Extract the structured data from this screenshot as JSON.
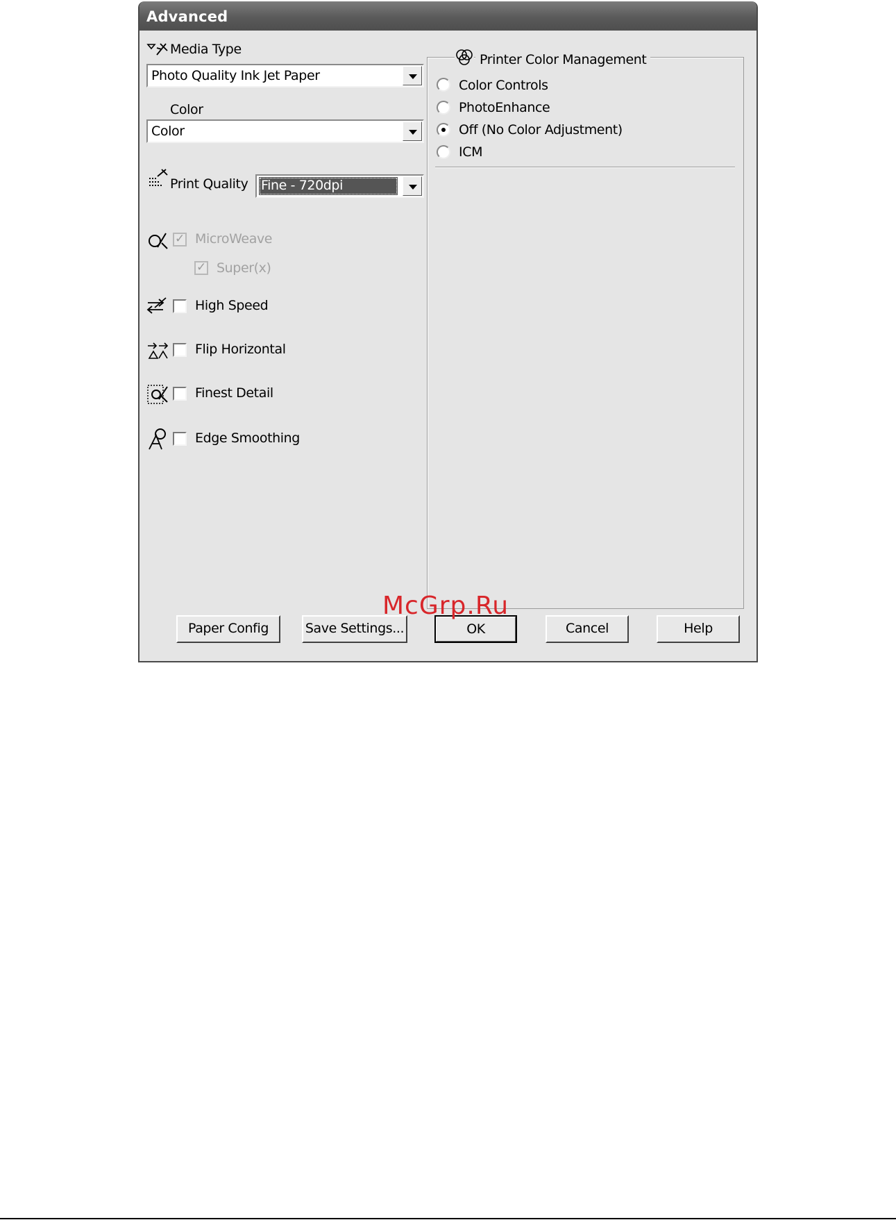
{
  "window": {
    "title": "Advanced"
  },
  "media_type": {
    "label": "Media Type",
    "value": "Photo Quality Ink Jet Paper"
  },
  "color": {
    "label": "Color",
    "value": "Color"
  },
  "print_quality": {
    "label": "Print Quality",
    "value": "Fine - 720dpi"
  },
  "options": {
    "microweave": {
      "label": "MicroWeave",
      "checked": true,
      "enabled": false
    },
    "superx": {
      "label": "Super(x)",
      "checked": true,
      "enabled": false
    },
    "high_speed": {
      "label": "High Speed",
      "checked": false
    },
    "flip_horizontal": {
      "label": "Flip Horizontal",
      "checked": false
    },
    "finest_detail": {
      "label": "Finest Detail",
      "checked": false
    },
    "edge_smoothing": {
      "label": "Edge Smoothing",
      "checked": false
    }
  },
  "color_management": {
    "title": "Printer Color Management",
    "options": [
      {
        "label": "Color Controls",
        "selected": false
      },
      {
        "label": "PhotoEnhance",
        "selected": false
      },
      {
        "label": "Off (No Color Adjustment)",
        "selected": true
      },
      {
        "label": "ICM",
        "selected": false
      }
    ]
  },
  "buttons": {
    "paper_config": "Paper Config",
    "save_settings": "Save Settings...",
    "ok": "OK",
    "cancel": "Cancel",
    "help": "Help"
  },
  "watermark": "McGrp.Ru",
  "colors": {
    "title_bar": "#5a5a5a",
    "dialog_bg": "#e5e5e5",
    "watermark": "#d8262a"
  }
}
